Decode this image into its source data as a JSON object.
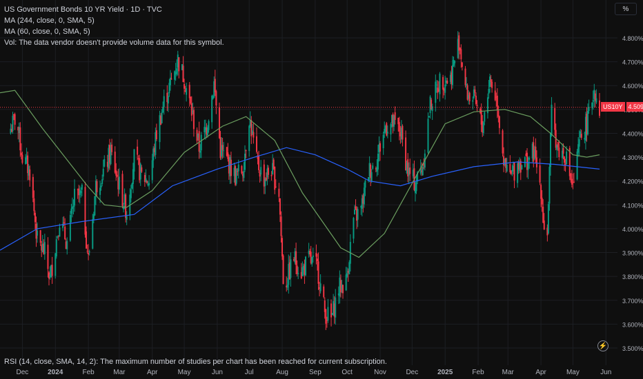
{
  "header": {
    "title": "US Government Bonds 10 YR Yield · 1D · TVC",
    "ma_long": "MA (244, close, 0, SMA, 5)",
    "ma_short": "MA (60, close, 0, SMA, 5)",
    "volume_note": "Vol: The data vendor doesn't provide volume data for this symbol."
  },
  "unit_label": "%",
  "rsi_note": "RSI (14, close, SMA, 14, 2): The maximum number of studies per chart has been reached for current subscription.",
  "price_tag": {
    "symbol": "US10Y",
    "value": "4.509%"
  },
  "icons": {
    "bolt": "lightning-icon"
  },
  "colors": {
    "background": "#0f0f0f",
    "up": "#089981",
    "down": "#f23645",
    "ma_long": "#2962ff",
    "ma_short": "#6b9e5f",
    "grid": "#1d1f24"
  },
  "chart_data": {
    "type": "candlestick",
    "title": "US Government Bonds 10 YR Yield · 1D · TVC",
    "ylabel": "%",
    "ylim": [
      3.5,
      4.85
    ],
    "y_ticks": [
      "4.800%",
      "4.700%",
      "4.600%",
      "4.500%",
      "4.400%",
      "4.300%",
      "4.200%",
      "4.100%",
      "4.000%",
      "3.900%",
      "3.800%",
      "3.700%",
      "3.600%",
      "3.500%"
    ],
    "x_ticks": [
      "Dec",
      "2024",
      "Feb",
      "Mar",
      "Apr",
      "May",
      "Jun",
      "Jul",
      "Aug",
      "Sep",
      "Oct",
      "Nov",
      "Dec",
      "2025",
      "Feb",
      "Mar",
      "Apr",
      "May",
      "Jun"
    ],
    "current_price": 4.509,
    "close_path": [
      [
        "2023-11-20",
        4.42
      ],
      [
        "2023-11-25",
        4.47
      ],
      [
        "2023-12-01",
        4.3
      ],
      [
        "2023-12-08",
        4.24
      ],
      [
        "2023-12-15",
        3.95
      ],
      [
        "2023-12-22",
        3.9
      ],
      [
        "2023-12-27",
        3.79
      ],
      [
        "2024-01-05",
        4.04
      ],
      [
        "2024-01-12",
        3.94
      ],
      [
        "2024-01-19",
        4.13
      ],
      [
        "2024-01-26",
        4.14
      ],
      [
        "2024-02-01",
        3.87
      ],
      [
        "2024-02-08",
        4.18
      ],
      [
        "2024-02-15",
        4.24
      ],
      [
        "2024-02-22",
        4.32
      ],
      [
        "2024-03-01",
        4.18
      ],
      [
        "2024-03-08",
        4.07
      ],
      [
        "2024-03-15",
        4.3
      ],
      [
        "2024-03-22",
        4.22
      ],
      [
        "2024-03-29",
        4.2
      ],
      [
        "2024-04-05",
        4.4
      ],
      [
        "2024-04-12",
        4.53
      ],
      [
        "2024-04-19",
        4.62
      ],
      [
        "2024-04-25",
        4.71
      ],
      [
        "2024-05-01",
        4.63
      ],
      [
        "2024-05-08",
        4.49
      ],
      [
        "2024-05-15",
        4.34
      ],
      [
        "2024-05-22",
        4.43
      ],
      [
        "2024-05-29",
        4.61
      ],
      [
        "2024-06-04",
        4.33
      ],
      [
        "2024-06-11",
        4.28
      ],
      [
        "2024-06-18",
        4.22
      ],
      [
        "2024-06-25",
        4.25
      ],
      [
        "2024-07-01",
        4.47
      ],
      [
        "2024-07-08",
        4.28
      ],
      [
        "2024-07-15",
        4.21
      ],
      [
        "2024-07-22",
        4.25
      ],
      [
        "2024-07-29",
        4.15
      ],
      [
        "2024-08-02",
        3.79
      ],
      [
        "2024-08-05",
        3.78
      ],
      [
        "2024-08-12",
        3.88
      ],
      [
        "2024-08-19",
        3.82
      ],
      [
        "2024-08-26",
        3.87
      ],
      [
        "2024-09-03",
        3.84
      ],
      [
        "2024-09-10",
        3.65
      ],
      [
        "2024-09-16",
        3.62
      ],
      [
        "2024-09-23",
        3.75
      ],
      [
        "2024-09-30",
        3.78
      ],
      [
        "2024-10-07",
        4.04
      ],
      [
        "2024-10-14",
        4.08
      ],
      [
        "2024-10-21",
        4.24
      ],
      [
        "2024-10-28",
        4.28
      ],
      [
        "2024-11-06",
        4.43
      ],
      [
        "2024-11-13",
        4.44
      ],
      [
        "2024-11-20",
        4.41
      ],
      [
        "2024-11-27",
        4.24
      ],
      [
        "2024-12-04",
        4.19
      ],
      [
        "2024-12-11",
        4.27
      ],
      [
        "2024-12-18",
        4.52
      ],
      [
        "2024-12-27",
        4.62
      ],
      [
        "2025-01-06",
        4.63
      ],
      [
        "2025-01-14",
        4.79
      ],
      [
        "2025-01-21",
        4.57
      ],
      [
        "2025-01-28",
        4.54
      ],
      [
        "2025-02-05",
        4.43
      ],
      [
        "2025-02-12",
        4.63
      ],
      [
        "2025-02-19",
        4.53
      ],
      [
        "2025-02-26",
        4.25
      ],
      [
        "2025-03-04",
        4.22
      ],
      [
        "2025-03-11",
        4.28
      ],
      [
        "2025-03-18",
        4.28
      ],
      [
        "2025-03-25",
        4.32
      ],
      [
        "2025-04-01",
        4.17
      ],
      [
        "2025-04-04",
        4.0
      ],
      [
        "2025-04-07",
        3.99
      ],
      [
        "2025-04-11",
        4.48
      ],
      [
        "2025-04-17",
        4.33
      ],
      [
        "2025-04-24",
        4.31
      ],
      [
        "2025-05-01",
        4.17
      ],
      [
        "2025-05-08",
        4.38
      ],
      [
        "2025-05-15",
        4.45
      ],
      [
        "2025-05-21",
        4.59
      ],
      [
        "2025-05-26",
        4.51
      ]
    ],
    "series": [
      {
        "name": "MA (244, close, 0, SMA, 5)",
        "points": [
          [
            "2023-11-10",
            3.91
          ],
          [
            "2023-12-15",
            4.0
          ],
          [
            "2024-01-26",
            4.03
          ],
          [
            "2024-03-15",
            4.06
          ],
          [
            "2024-04-20",
            4.18
          ],
          [
            "2024-06-01",
            4.25
          ],
          [
            "2024-07-06",
            4.3
          ],
          [
            "2024-08-05",
            4.34
          ],
          [
            "2024-09-01",
            4.31
          ],
          [
            "2024-10-01",
            4.25
          ],
          [
            "2024-10-22",
            4.2
          ],
          [
            "2024-11-20",
            4.18
          ],
          [
            "2024-12-20",
            4.22
          ],
          [
            "2025-01-28",
            4.26
          ],
          [
            "2025-03-10",
            4.28
          ],
          [
            "2025-04-14",
            4.27
          ],
          [
            "2025-05-26",
            4.25
          ]
        ]
      },
      {
        "name": "MA (60, close, 0, SMA, 5)",
        "points": [
          [
            "2023-11-10",
            4.57
          ],
          [
            "2023-11-24",
            4.58
          ],
          [
            "2023-12-20",
            4.42
          ],
          [
            "2024-01-31",
            4.18
          ],
          [
            "2024-02-16",
            4.1
          ],
          [
            "2024-03-08",
            4.09
          ],
          [
            "2024-04-01",
            4.16
          ],
          [
            "2024-05-01",
            4.32
          ],
          [
            "2024-06-06",
            4.43
          ],
          [
            "2024-06-28",
            4.47
          ],
          [
            "2024-07-25",
            4.37
          ],
          [
            "2024-08-20",
            4.15
          ],
          [
            "2024-09-25",
            3.92
          ],
          [
            "2024-10-12",
            3.88
          ],
          [
            "2024-11-05",
            3.98
          ],
          [
            "2024-12-01",
            4.19
          ],
          [
            "2025-01-01",
            4.44
          ],
          [
            "2025-01-28",
            4.49
          ],
          [
            "2025-02-26",
            4.5
          ],
          [
            "2025-03-22",
            4.47
          ],
          [
            "2025-04-10",
            4.4
          ],
          [
            "2025-05-01",
            4.31
          ],
          [
            "2025-05-14",
            4.3
          ],
          [
            "2025-05-26",
            4.31
          ]
        ]
      }
    ]
  }
}
